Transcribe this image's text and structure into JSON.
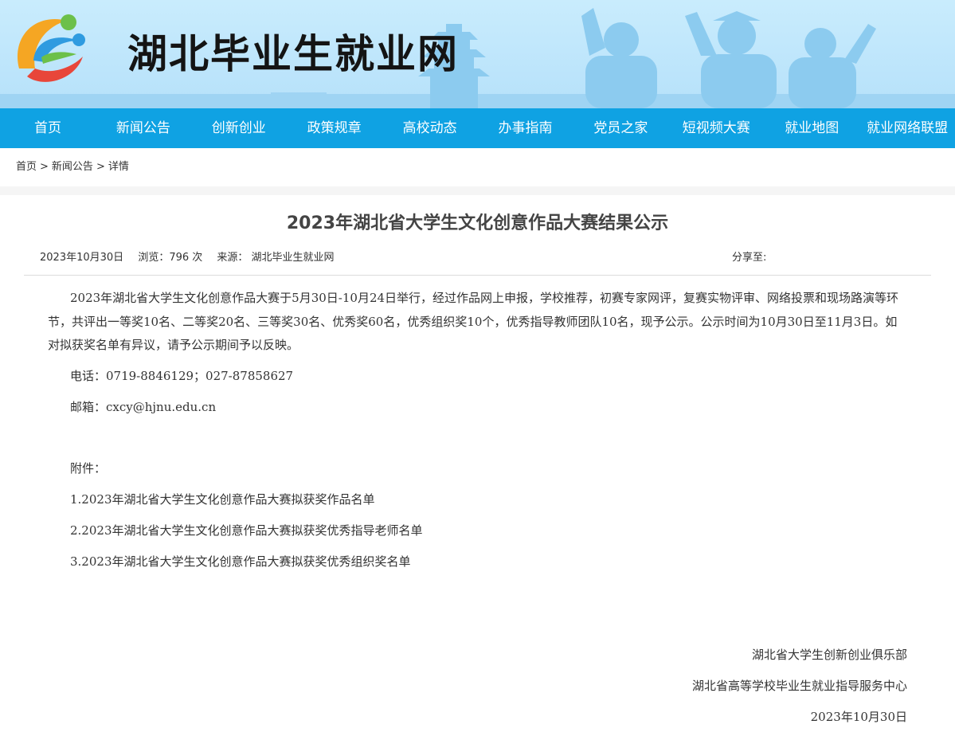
{
  "site": {
    "title": "湖北毕业生就业网"
  },
  "nav": [
    {
      "label": "首页"
    },
    {
      "label": "新闻公告"
    },
    {
      "label": "创新创业"
    },
    {
      "label": "政策规章"
    },
    {
      "label": "高校动态"
    },
    {
      "label": "办事指南"
    },
    {
      "label": "党员之家"
    },
    {
      "label": "短视频大赛"
    },
    {
      "label": "就业地图"
    },
    {
      "label": "就业网络联盟"
    }
  ],
  "breadcrumb": {
    "home": "首页",
    "section": "新闻公告",
    "current": "详情",
    "separator": ">"
  },
  "article": {
    "title": "2023年湖北省大学生文化创意作品大赛结果公示",
    "date": "2023年10月30日",
    "views": "浏览：796 次",
    "source": "来源：  湖北毕业生就业网",
    "share": "分享至:",
    "body": "2023年湖北省大学生文化创意作品大赛于5月30日-10月24日举行，经过作品网上申报，学校推荐，初赛专家网评，复赛实物评审、网络投票和现场路演等环节，共评出一等奖10名、二等奖20名、三等奖30名、优秀奖60名，优秀组织奖10个，优秀指导教师团队10名，现予公示。公示时间为10月30日至11月3日。如对拟获奖名单有异议，请予公示期间予以反映。",
    "phone": "电话：0719-8846129；027-87858627",
    "email": "邮箱：cxcy@hjnu.edu.cn",
    "attachments_label": "附件：",
    "attachments": [
      "1.2023年湖北省大学生文化创意作品大赛拟获奖作品名单",
      "2.2023年湖北省大学生文化创意作品大赛拟获奖优秀指导老师名单",
      "3.2023年湖北省大学生文化创意作品大赛拟获奖优秀组织奖名单"
    ],
    "signature": [
      "湖北省大学生创新创业俱乐部",
      "湖北省高等学校毕业生就业指导服务中心",
      "2023年10月30日"
    ]
  },
  "colors": {
    "nav_bg": "#0fa2e3",
    "banner_bg": "#bfe6fb",
    "title_text": "#444444"
  },
  "icons": {
    "logo": "ribbon-logo-icon"
  }
}
